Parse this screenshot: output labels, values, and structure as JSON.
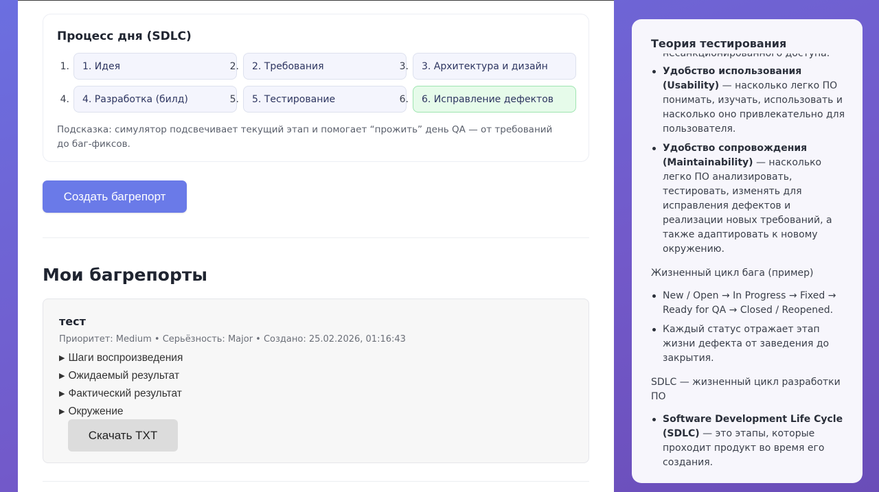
{
  "sdlc": {
    "title": "Процесс дня (SDLC)",
    "stages": [
      {
        "num": "1.",
        "label": "1. Идея",
        "active": false
      },
      {
        "num": "2.",
        "label": "2. Требования",
        "active": false
      },
      {
        "num": "3.",
        "label": "3. Архитектура и дизайн",
        "active": false
      },
      {
        "num": "4.",
        "label": "4. Разработка (билд)",
        "active": false
      },
      {
        "num": "5.",
        "label": "5. Тестирование",
        "active": false
      },
      {
        "num": "6.",
        "label": "6. Исправление дефектов",
        "active": true
      }
    ],
    "hint": "Подсказка: симулятор подсвечивает текущий этап и помогает “прожить” день QA — от требований до баг-фиксов."
  },
  "actions": {
    "create_label": "Создать багрепорт"
  },
  "reports": {
    "title": "Мои багрепорты",
    "items": [
      {
        "name": "тест",
        "meta": "Приоритет: Medium • Серьёзность: Major • Создано: 25.02.2026, 01:16:43",
        "sections": [
          "Шаги воспроизведения",
          "Ожидаемый результат",
          "Фактический результат",
          "Окружение"
        ],
        "download_label": "Скачать TXT"
      }
    ]
  },
  "theory": {
    "title": "Теория тестирования",
    "cut_text": "несанкционированного доступа.",
    "quality_items": [
      {
        "term": "Удобство использования (Usability)",
        "text": " — насколько легко ПО понимать, изучать, использовать и насколько оно привлекательно для пользователя."
      },
      {
        "term": "Удобство сопровождения (Maintainability)",
        "text": " — насколько легко ПО анализировать, тестировать, изменять для исправления дефектов и реализации новых требований, а также адаптировать к новому окружению."
      }
    ],
    "bug_lifecycle_title": "Жизненный цикл бага (пример)",
    "bug_lifecycle_items": [
      "New / Open → In Progress → Fixed → Ready for QA → Closed / Reopened.",
      "Каждый статус отражает этап жизни дефекта от заведения до закрытия."
    ],
    "sdlc_title": "SDLC — жизненный цикл разработки ПО",
    "sdlc_items": [
      {
        "term": "Software Development Life Cycle (SDLC)",
        "text": " — это этапы, которые проходит продукт во время его создания."
      }
    ]
  }
}
